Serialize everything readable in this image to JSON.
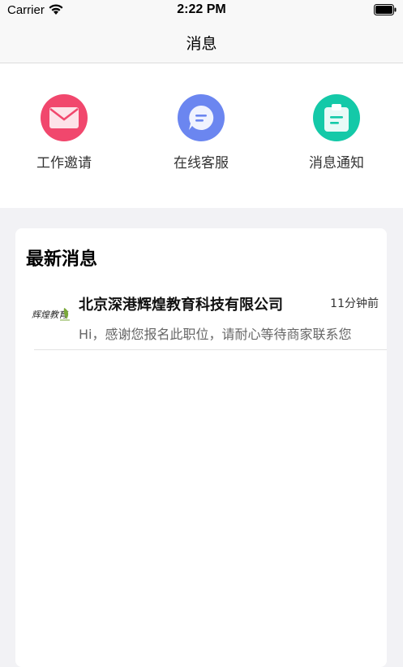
{
  "status_bar": {
    "carrier": "Carrier",
    "time": "2:22 PM"
  },
  "nav": {
    "title": "消息"
  },
  "shortcuts": [
    {
      "label": "工作邀请",
      "icon": "envelope-icon",
      "color": "#f1476d"
    },
    {
      "label": "在线客服",
      "icon": "chat-bubble-icon",
      "color": "#6b86f0"
    },
    {
      "label": "消息通知",
      "icon": "clipboard-icon",
      "color": "#14c9a8"
    }
  ],
  "latest": {
    "title": "最新消息",
    "messages": [
      {
        "sender": "北京深港辉煌教育科技有限公司",
        "time": "11分钟前",
        "preview": "Hi，感谢您报名此职位，请耐心等待商家联系您",
        "avatar_text": "辉煌教育",
        "avatar_color": "#5a8a2a"
      }
    ]
  }
}
